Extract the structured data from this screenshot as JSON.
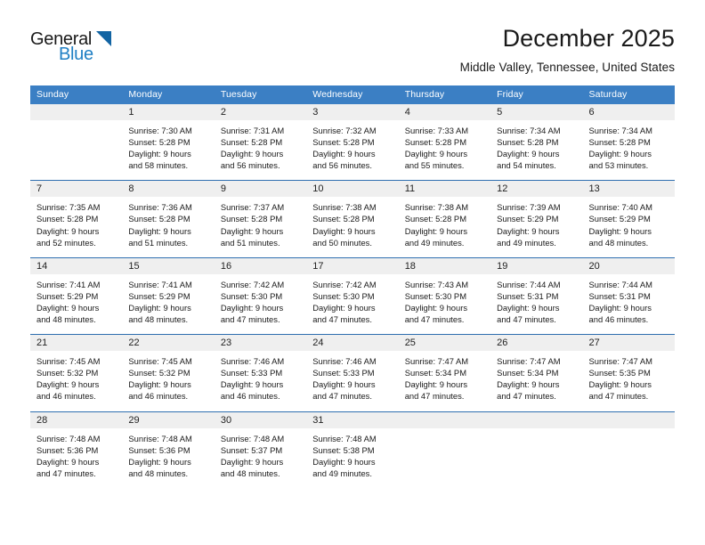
{
  "brand": {
    "name_part1": "General",
    "name_part2": "Blue",
    "triangle_color": "#1264a3",
    "blue_color": "#1f7fc4"
  },
  "header": {
    "title": "December 2025",
    "subtitle": "Middle Valley, Tennessee, United States",
    "header_bg": "#3b7fc4",
    "daynum_bg": "#efefef",
    "row_divider": "#2f6fb0"
  },
  "weekdays": [
    "Sunday",
    "Monday",
    "Tuesday",
    "Wednesday",
    "Thursday",
    "Friday",
    "Saturday"
  ],
  "weeks": [
    [
      {
        "day": "",
        "l1": "",
        "l2": "",
        "l3": "",
        "l4": ""
      },
      {
        "day": "1",
        "l1": "Sunrise: 7:30 AM",
        "l2": "Sunset: 5:28 PM",
        "l3": "Daylight: 9 hours",
        "l4": "and 58 minutes."
      },
      {
        "day": "2",
        "l1": "Sunrise: 7:31 AM",
        "l2": "Sunset: 5:28 PM",
        "l3": "Daylight: 9 hours",
        "l4": "and 56 minutes."
      },
      {
        "day": "3",
        "l1": "Sunrise: 7:32 AM",
        "l2": "Sunset: 5:28 PM",
        "l3": "Daylight: 9 hours",
        "l4": "and 56 minutes."
      },
      {
        "day": "4",
        "l1": "Sunrise: 7:33 AM",
        "l2": "Sunset: 5:28 PM",
        "l3": "Daylight: 9 hours",
        "l4": "and 55 minutes."
      },
      {
        "day": "5",
        "l1": "Sunrise: 7:34 AM",
        "l2": "Sunset: 5:28 PM",
        "l3": "Daylight: 9 hours",
        "l4": "and 54 minutes."
      },
      {
        "day": "6",
        "l1": "Sunrise: 7:34 AM",
        "l2": "Sunset: 5:28 PM",
        "l3": "Daylight: 9 hours",
        "l4": "and 53 minutes."
      }
    ],
    [
      {
        "day": "7",
        "l1": "Sunrise: 7:35 AM",
        "l2": "Sunset: 5:28 PM",
        "l3": "Daylight: 9 hours",
        "l4": "and 52 minutes."
      },
      {
        "day": "8",
        "l1": "Sunrise: 7:36 AM",
        "l2": "Sunset: 5:28 PM",
        "l3": "Daylight: 9 hours",
        "l4": "and 51 minutes."
      },
      {
        "day": "9",
        "l1": "Sunrise: 7:37 AM",
        "l2": "Sunset: 5:28 PM",
        "l3": "Daylight: 9 hours",
        "l4": "and 51 minutes."
      },
      {
        "day": "10",
        "l1": "Sunrise: 7:38 AM",
        "l2": "Sunset: 5:28 PM",
        "l3": "Daylight: 9 hours",
        "l4": "and 50 minutes."
      },
      {
        "day": "11",
        "l1": "Sunrise: 7:38 AM",
        "l2": "Sunset: 5:28 PM",
        "l3": "Daylight: 9 hours",
        "l4": "and 49 minutes."
      },
      {
        "day": "12",
        "l1": "Sunrise: 7:39 AM",
        "l2": "Sunset: 5:29 PM",
        "l3": "Daylight: 9 hours",
        "l4": "and 49 minutes."
      },
      {
        "day": "13",
        "l1": "Sunrise: 7:40 AM",
        "l2": "Sunset: 5:29 PM",
        "l3": "Daylight: 9 hours",
        "l4": "and 48 minutes."
      }
    ],
    [
      {
        "day": "14",
        "l1": "Sunrise: 7:41 AM",
        "l2": "Sunset: 5:29 PM",
        "l3": "Daylight: 9 hours",
        "l4": "and 48 minutes."
      },
      {
        "day": "15",
        "l1": "Sunrise: 7:41 AM",
        "l2": "Sunset: 5:29 PM",
        "l3": "Daylight: 9 hours",
        "l4": "and 48 minutes."
      },
      {
        "day": "16",
        "l1": "Sunrise: 7:42 AM",
        "l2": "Sunset: 5:30 PM",
        "l3": "Daylight: 9 hours",
        "l4": "and 47 minutes."
      },
      {
        "day": "17",
        "l1": "Sunrise: 7:42 AM",
        "l2": "Sunset: 5:30 PM",
        "l3": "Daylight: 9 hours",
        "l4": "and 47 minutes."
      },
      {
        "day": "18",
        "l1": "Sunrise: 7:43 AM",
        "l2": "Sunset: 5:30 PM",
        "l3": "Daylight: 9 hours",
        "l4": "and 47 minutes."
      },
      {
        "day": "19",
        "l1": "Sunrise: 7:44 AM",
        "l2": "Sunset: 5:31 PM",
        "l3": "Daylight: 9 hours",
        "l4": "and 47 minutes."
      },
      {
        "day": "20",
        "l1": "Sunrise: 7:44 AM",
        "l2": "Sunset: 5:31 PM",
        "l3": "Daylight: 9 hours",
        "l4": "and 46 minutes."
      }
    ],
    [
      {
        "day": "21",
        "l1": "Sunrise: 7:45 AM",
        "l2": "Sunset: 5:32 PM",
        "l3": "Daylight: 9 hours",
        "l4": "and 46 minutes."
      },
      {
        "day": "22",
        "l1": "Sunrise: 7:45 AM",
        "l2": "Sunset: 5:32 PM",
        "l3": "Daylight: 9 hours",
        "l4": "and 46 minutes."
      },
      {
        "day": "23",
        "l1": "Sunrise: 7:46 AM",
        "l2": "Sunset: 5:33 PM",
        "l3": "Daylight: 9 hours",
        "l4": "and 46 minutes."
      },
      {
        "day": "24",
        "l1": "Sunrise: 7:46 AM",
        "l2": "Sunset: 5:33 PM",
        "l3": "Daylight: 9 hours",
        "l4": "and 47 minutes."
      },
      {
        "day": "25",
        "l1": "Sunrise: 7:47 AM",
        "l2": "Sunset: 5:34 PM",
        "l3": "Daylight: 9 hours",
        "l4": "and 47 minutes."
      },
      {
        "day": "26",
        "l1": "Sunrise: 7:47 AM",
        "l2": "Sunset: 5:34 PM",
        "l3": "Daylight: 9 hours",
        "l4": "and 47 minutes."
      },
      {
        "day": "27",
        "l1": "Sunrise: 7:47 AM",
        "l2": "Sunset: 5:35 PM",
        "l3": "Daylight: 9 hours",
        "l4": "and 47 minutes."
      }
    ],
    [
      {
        "day": "28",
        "l1": "Sunrise: 7:48 AM",
        "l2": "Sunset: 5:36 PM",
        "l3": "Daylight: 9 hours",
        "l4": "and 47 minutes."
      },
      {
        "day": "29",
        "l1": "Sunrise: 7:48 AM",
        "l2": "Sunset: 5:36 PM",
        "l3": "Daylight: 9 hours",
        "l4": "and 48 minutes."
      },
      {
        "day": "30",
        "l1": "Sunrise: 7:48 AM",
        "l2": "Sunset: 5:37 PM",
        "l3": "Daylight: 9 hours",
        "l4": "and 48 minutes."
      },
      {
        "day": "31",
        "l1": "Sunrise: 7:48 AM",
        "l2": "Sunset: 5:38 PM",
        "l3": "Daylight: 9 hours",
        "l4": "and 49 minutes."
      },
      {
        "day": "",
        "l1": "",
        "l2": "",
        "l3": "",
        "l4": ""
      },
      {
        "day": "",
        "l1": "",
        "l2": "",
        "l3": "",
        "l4": ""
      },
      {
        "day": "",
        "l1": "",
        "l2": "",
        "l3": "",
        "l4": ""
      }
    ]
  ]
}
